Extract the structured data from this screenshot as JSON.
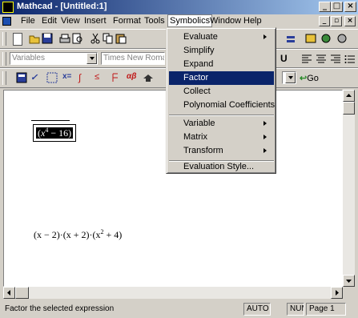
{
  "window": {
    "app_title": "Mathcad - [Untitled:1]",
    "caption_buttons": [
      "_",
      "□",
      "×"
    ]
  },
  "menubar": {
    "items": [
      "File",
      "Edit",
      "View",
      "Insert",
      "Format",
      "Tools",
      "Symbolics",
      "Window",
      "Help"
    ],
    "open_menu": "Symbolics"
  },
  "format_bar": {
    "style": "Variables",
    "font": "Times New Roman"
  },
  "symbolics_menu": {
    "items": [
      {
        "label": "Evaluate",
        "submenu": true
      },
      {
        "label": "Simplify",
        "submenu": false
      },
      {
        "label": "Expand",
        "submenu": false
      },
      {
        "label": "Factor",
        "submenu": false,
        "highlighted": true
      },
      {
        "label": "Collect",
        "submenu": false
      },
      {
        "label": "Polynomial Coefficients",
        "submenu": false
      },
      {
        "label": "Variable",
        "submenu": true
      },
      {
        "label": "Matrix",
        "submenu": true
      },
      {
        "label": "Transform",
        "submenu": true
      },
      {
        "label": "Evaluation Style...",
        "submenu": false
      }
    ]
  },
  "toolbar3": {
    "go_label": "Go"
  },
  "worksheet": {
    "selected_expression": {
      "base": "x",
      "exponent": "4",
      "tail": " − 16"
    },
    "factored_result": "(x − 2)·(x + 2)·(x",
    "factored_exponent": "2",
    "factored_tail": " + 4)"
  },
  "statusbar": {
    "message": "Factor the selected expression",
    "mode": "AUTO",
    "num": "NUM",
    "page": "Page 1"
  },
  "icons": [
    "app-icon",
    "new-icon",
    "open-icon",
    "save-icon",
    "print-icon",
    "print-preview-icon",
    "cut-icon",
    "copy-icon",
    "paste-icon",
    "calculator-palette-icon",
    "graph-palette-icon",
    "matrix-palette-icon",
    "evaluation-palette-icon",
    "calculus-palette-icon",
    "boolean-palette-icon",
    "programming-palette-icon",
    "greek-palette-icon",
    "symbolic-palette-icon",
    "resource-center-icon",
    "go-icon"
  ]
}
